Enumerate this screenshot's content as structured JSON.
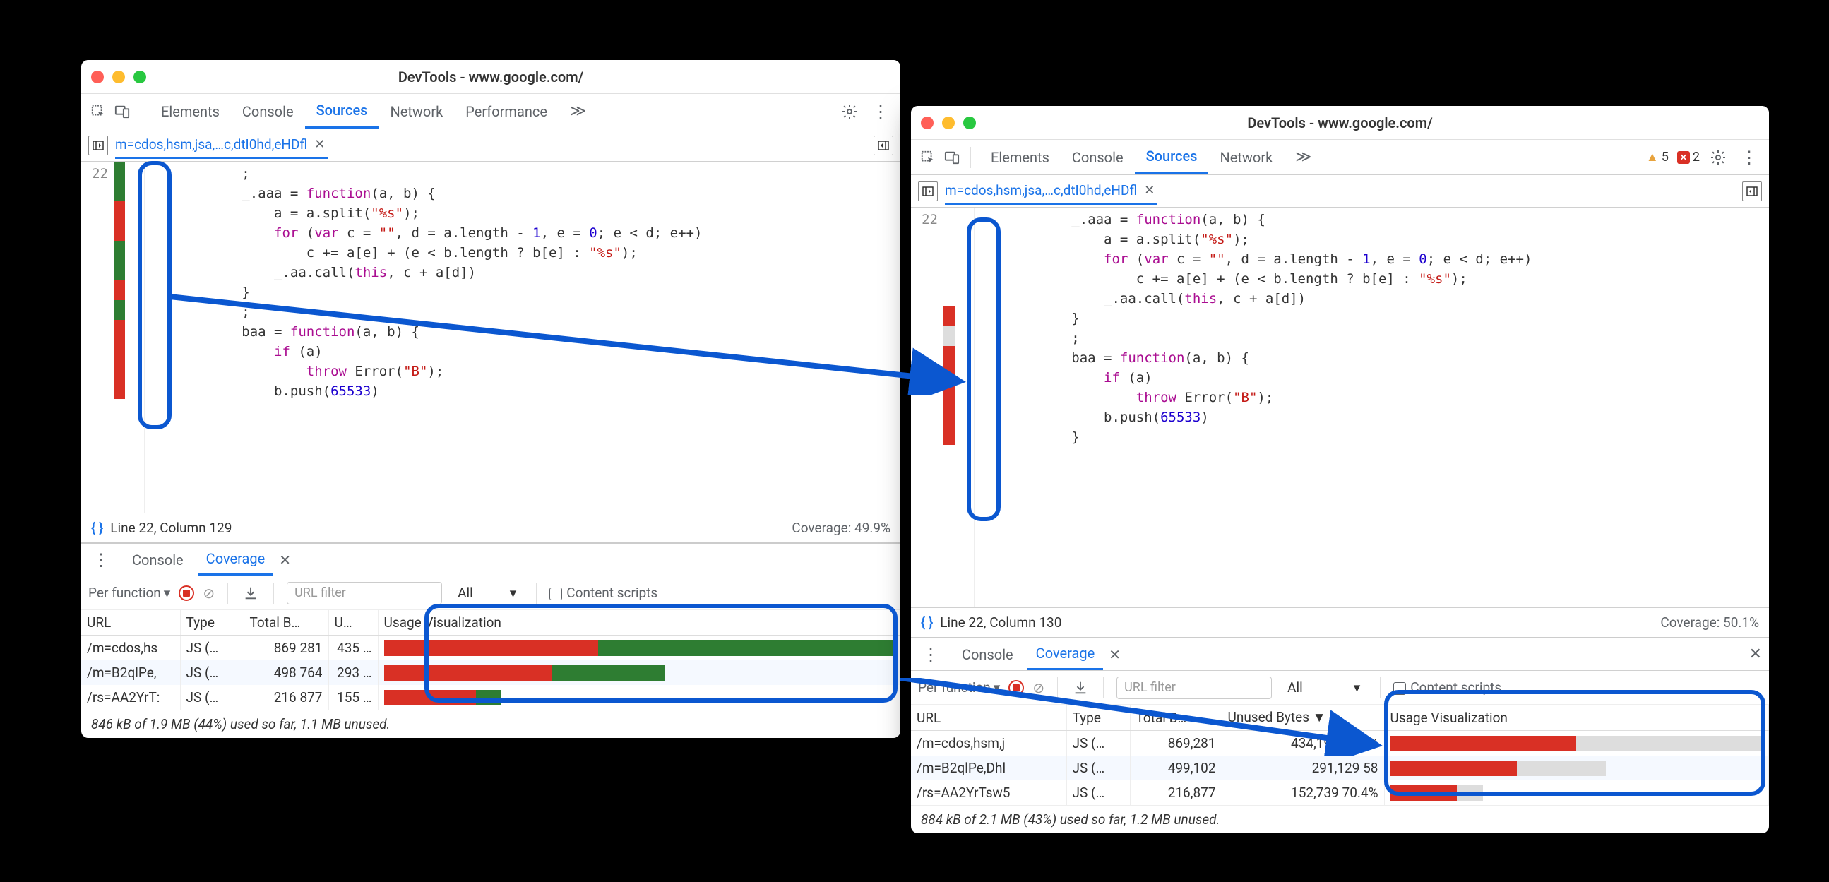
{
  "left": {
    "title": "DevTools - www.google.com/",
    "tabs": [
      "Elements",
      "Console",
      "Sources",
      "Network",
      "Performance"
    ],
    "active_tab": "Sources",
    "more": "≫",
    "file_tab": "m=cdos,hsm,jsa,…c,dtI0hd,eHDfl",
    "code": {
      "line": "22",
      "lines": [
        "            ;",
        "            _.aaa = function(a, b) {",
        "                a = a.split(\"%s\");",
        "                for (var c = \"\", d = a.length - 1, e = 0; e < d; e++)",
        "                    c += a[e] + (e < b.length ? b[e] : \"%s\");",
        "                _.aa.call(this, c + a[d])",
        "            }",
        "            ;",
        "            baa = function(a, b) {",
        "                if (a)",
        "                    throw Error(\"B\");",
        "                b.push(65533)"
      ]
    },
    "status": {
      "pos": "Line 22, Column 129",
      "coverage": "Coverage: 49.9%"
    },
    "drawer_tabs": [
      "Console",
      "Coverage"
    ],
    "drawer_active": "Coverage",
    "cov_toolbar": {
      "mode": "Per function",
      "filter_placeholder": "URL filter",
      "type": "All",
      "content_scripts": "Content scripts"
    },
    "cov_headers": [
      "URL",
      "Type",
      "Total B…",
      "U…",
      "Usage Visualization"
    ],
    "cov_rows": [
      {
        "url": "/m=cdos,hs",
        "type": "JS (…",
        "total": "869 281",
        "unused": "435 …",
        "red": 42,
        "green": 58,
        "grey": 0,
        "scale": 100
      },
      {
        "url": "/m=B2qlPe,",
        "type": "JS (…",
        "total": "498 764",
        "unused": "293 …",
        "red": 33,
        "green": 22,
        "grey": 0,
        "scale": 55
      },
      {
        "url": "/rs=AA2YrT:",
        "type": "JS (…",
        "total": "216 877",
        "unused": "155 …",
        "red": 18,
        "green": 5,
        "grey": 0,
        "scale": 23
      }
    ],
    "cov_footer": "846 kB of 1.9 MB (44%) used so far, 1.1 MB unused."
  },
  "right": {
    "title": "DevTools - www.google.com/",
    "tabs": [
      "Elements",
      "Console",
      "Sources",
      "Network"
    ],
    "active_tab": "Sources",
    "more": "≫",
    "warn_count": "5",
    "err_count": "2",
    "file_tab": "m=cdos,hsm,jsa,…c,dtI0hd,eHDfl",
    "code": {
      "line": "22",
      "lines": [
        "            _.aaa = function(a, b) {",
        "                a = a.split(\"%s\");",
        "                for (var c = \"\", d = a.length - 1, e = 0; e < d; e++)",
        "                    c += a[e] + (e < b.length ? b[e] : \"%s\");",
        "                _.aa.call(this, c + a[d])",
        "            }",
        "            ;",
        "            baa = function(a, b) {",
        "                if (a)",
        "                    throw Error(\"B\");",
        "                b.push(65533)",
        "            }"
      ]
    },
    "status": {
      "pos": "Line 22, Column 130",
      "coverage": "Coverage: 50.1%"
    },
    "drawer_tabs": [
      "Console",
      "Coverage"
    ],
    "drawer_active": "Coverage",
    "cov_toolbar": {
      "mode": "Per function",
      "filter_placeholder": "URL filter",
      "type": "All",
      "content_scripts": "Content scripts"
    },
    "cov_headers": [
      "URL",
      "Type",
      "Total B…",
      "Unused Bytes ▼",
      "Usage Visualization"
    ],
    "cov_rows": [
      {
        "url": "/m=cdos,hsm,j",
        "type": "JS (…",
        "total": "869,281",
        "unused": "434,192  49.9%",
        "red": 50,
        "grey": 50,
        "scale": 100
      },
      {
        "url": "/m=B2qlPe,Dhl",
        "type": "JS (…",
        "total": "499,102",
        "unused": "291,129  58",
        "red": 34,
        "grey": 24,
        "scale": 58
      },
      {
        "url": "/rs=AA2YrTsw5",
        "type": "JS (…",
        "total": "216,877",
        "unused": "152,739  70.4%",
        "red": 18,
        "grey": 7,
        "scale": 25
      }
    ],
    "cov_footer": "884 kB of 2.1 MB (43%) used so far, 1.2 MB unused."
  }
}
